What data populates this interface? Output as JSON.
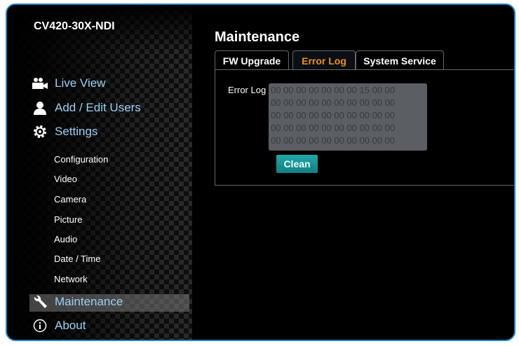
{
  "device_name": "CV420-30X-NDI",
  "nav": {
    "live_view": "Live View",
    "users": "Add / Edit Users",
    "settings": "Settings",
    "sub": [
      "Configuration",
      "Video",
      "Camera",
      "Picture",
      "Audio",
      "Date / Time",
      "Network"
    ],
    "maintenance": "Maintenance",
    "about": "About"
  },
  "page_title": "Maintenance",
  "tabs": [
    "FW Upgrade",
    "Error Log",
    "System Service"
  ],
  "active_tab": "Error Log",
  "error_log": {
    "label": "Error Log",
    "value": "00 00 00 00 00 00 00 15 00 00\n00 00 00 00 00 00 00 00 00 00\n00 00 00 00 00 00 00 00 00 00\n00 00 00 00 00 00 00 00 00 00\n00 00 00 00 00 00 00 00 00 00",
    "clean_label": "Clean"
  },
  "colors": {
    "accent": "#f0901e",
    "link": "#9bd0f5",
    "button": "#1a9a9a",
    "frame": "#1e86c8"
  }
}
